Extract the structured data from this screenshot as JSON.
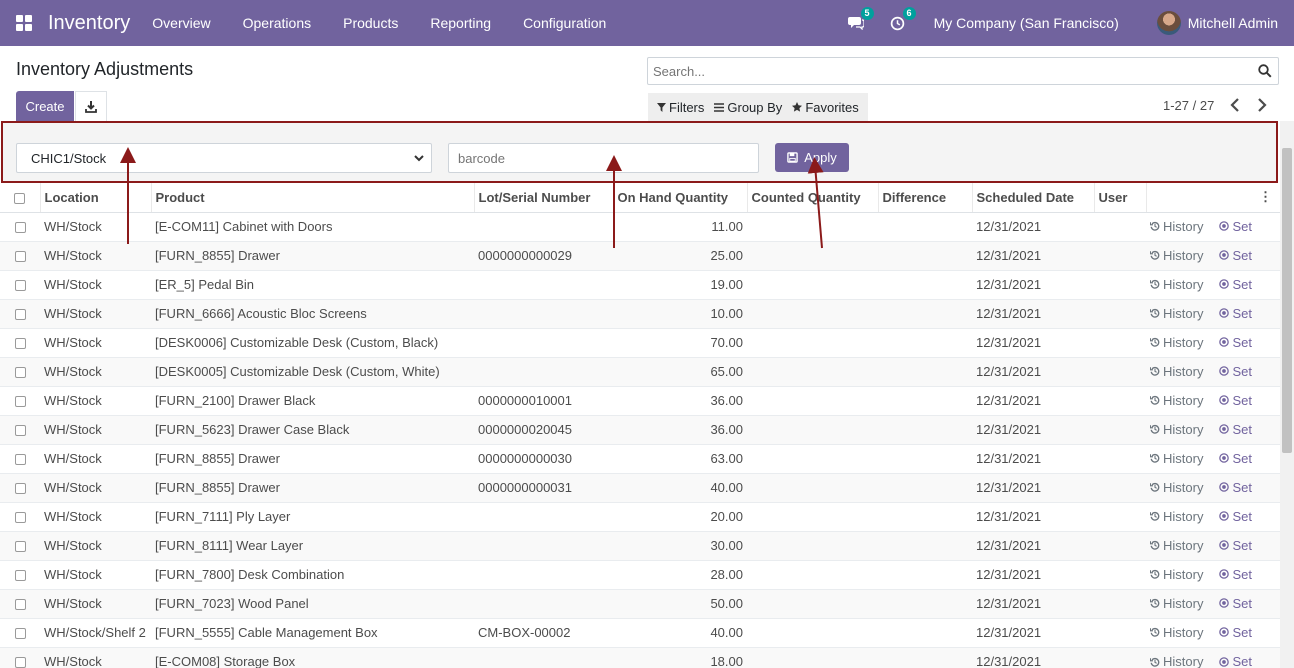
{
  "navbar": {
    "brand": "Inventory",
    "menu": [
      "Overview",
      "Operations",
      "Products",
      "Reporting",
      "Configuration"
    ],
    "messages_count": "5",
    "activities_count": "6",
    "company": "My Company (San Francisco)",
    "user": "Mitchell Admin"
  },
  "control": {
    "title": "Inventory Adjustments",
    "create_label": "Create",
    "search_placeholder": "Search...",
    "filters_label": "Filters",
    "groupby_label": "Group By",
    "favorites_label": "Favorites",
    "pager": "1-27 / 27"
  },
  "adjust": {
    "location_value": "CHIC1/Stock",
    "barcode_placeholder": "barcode",
    "apply_label": "Apply"
  },
  "table": {
    "columns": [
      "Location",
      "Product",
      "Lot/Serial Number",
      "On Hand Quantity",
      "Counted Quantity",
      "Difference",
      "Scheduled Date",
      "User"
    ],
    "history_label": "History",
    "set_label": "Set",
    "rows": [
      {
        "location": "WH/Stock",
        "product": "[E-COM11] Cabinet with Doors",
        "lot": "",
        "qty": "11.00",
        "date": "12/31/2021"
      },
      {
        "location": "WH/Stock",
        "product": "[FURN_8855] Drawer",
        "lot": "0000000000029",
        "qty": "25.00",
        "date": "12/31/2021"
      },
      {
        "location": "WH/Stock",
        "product": "[ER_5] Pedal Bin",
        "lot": "",
        "qty": "19.00",
        "date": "12/31/2021"
      },
      {
        "location": "WH/Stock",
        "product": "[FURN_6666] Acoustic Bloc Screens",
        "lot": "",
        "qty": "10.00",
        "date": "12/31/2021"
      },
      {
        "location": "WH/Stock",
        "product": "[DESK0006] Customizable Desk (Custom, Black)",
        "lot": "",
        "qty": "70.00",
        "date": "12/31/2021"
      },
      {
        "location": "WH/Stock",
        "product": "[DESK0005] Customizable Desk (Custom, White)",
        "lot": "",
        "qty": "65.00",
        "date": "12/31/2021"
      },
      {
        "location": "WH/Stock",
        "product": "[FURN_2100] Drawer Black",
        "lot": "0000000010001",
        "qty": "36.00",
        "date": "12/31/2021"
      },
      {
        "location": "WH/Stock",
        "product": "[FURN_5623] Drawer Case Black",
        "lot": "0000000020045",
        "qty": "36.00",
        "date": "12/31/2021"
      },
      {
        "location": "WH/Stock",
        "product": "[FURN_8855] Drawer",
        "lot": "0000000000030",
        "qty": "63.00",
        "date": "12/31/2021"
      },
      {
        "location": "WH/Stock",
        "product": "[FURN_8855] Drawer",
        "lot": "0000000000031",
        "qty": "40.00",
        "date": "12/31/2021"
      },
      {
        "location": "WH/Stock",
        "product": "[FURN_7111] Ply Layer",
        "lot": "",
        "qty": "20.00",
        "date": "12/31/2021"
      },
      {
        "location": "WH/Stock",
        "product": "[FURN_8111] Wear Layer",
        "lot": "",
        "qty": "30.00",
        "date": "12/31/2021"
      },
      {
        "location": "WH/Stock",
        "product": "[FURN_7800] Desk Combination",
        "lot": "",
        "qty": "28.00",
        "date": "12/31/2021"
      },
      {
        "location": "WH/Stock",
        "product": "[FURN_7023] Wood Panel",
        "lot": "",
        "qty": "50.00",
        "date": "12/31/2021"
      },
      {
        "location": "WH/Stock/Shelf 2",
        "product": "[FURN_5555] Cable Management Box",
        "lot": "CM-BOX-00002",
        "qty": "40.00",
        "date": "12/31/2021"
      },
      {
        "location": "WH/Stock",
        "product": "[E-COM08] Storage Box",
        "lot": "",
        "qty": "18.00",
        "date": "12/31/2021"
      }
    ]
  },
  "colors": {
    "primary": "#71639e",
    "annotation": "#8b1a1a",
    "badge": "#00a09d"
  }
}
